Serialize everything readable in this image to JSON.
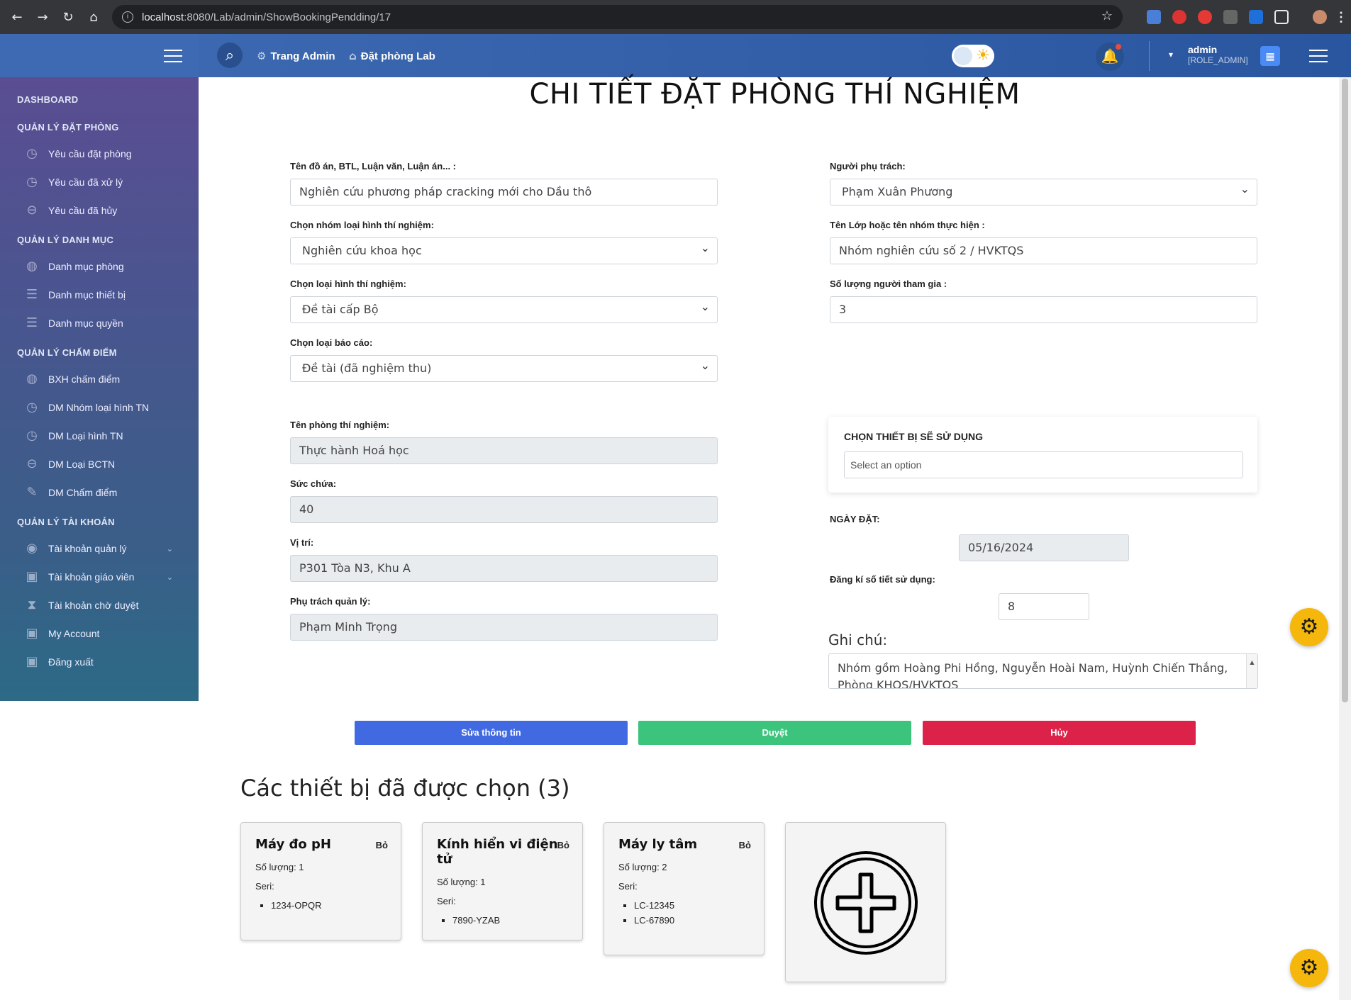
{
  "browser": {
    "url_host": "localhost",
    "url_path": ":8080/Lab/admin/ShowBookingPendding/17",
    "info_icon": "i",
    "back": "←",
    "forward": "→",
    "reload": "↻",
    "home": "⌂",
    "star": "☆"
  },
  "header": {
    "links": [
      "Trang Admin",
      "Đặt phòng Lab"
    ],
    "user_name": "admin",
    "user_role": "[ROLE_ADMIN]"
  },
  "sidebar": {
    "sections": [
      {
        "title": "DASHBOARD",
        "items": []
      },
      {
        "title": "QUẢN LÝ ĐẶT PHÒNG",
        "items": [
          {
            "label": "Yêu cầu đặt phòng",
            "icon": "clock-icon"
          },
          {
            "label": "Yêu cầu đã xử lý",
            "icon": "clock-icon"
          },
          {
            "label": "Yêu cầu đã hủy",
            "icon": "minus-circle-icon"
          }
        ]
      },
      {
        "title": "QUẢN LÝ DANH MỤC",
        "items": [
          {
            "label": "Danh mục phòng",
            "icon": "basketball-icon"
          },
          {
            "label": "Danh mục thiết bị",
            "icon": "database-icon"
          },
          {
            "label": "Danh mục quyền",
            "icon": "database-icon"
          }
        ]
      },
      {
        "title": "QUẢN LÝ CHẤM ĐIỂM",
        "items": [
          {
            "label": "BXH chấm điểm",
            "icon": "basketball-icon"
          },
          {
            "label": "DM Nhóm loại hình TN",
            "icon": "clock-icon"
          },
          {
            "label": "DM Loại hình TN",
            "icon": "clock-icon"
          },
          {
            "label": "DM Loại BCTN",
            "icon": "minus-circle-icon"
          },
          {
            "label": "DM Chấm điểm",
            "icon": "pencil-icon"
          }
        ]
      },
      {
        "title": "QUẢN LÝ TÀI KHOẢN",
        "items": [
          {
            "label": "Tài khoản quản lý",
            "icon": "badge-icon"
          },
          {
            "label": "Tài khoản giáo viên",
            "icon": "id-card-icon"
          },
          {
            "label": "Tài khoản chờ duyệt",
            "icon": "hourglass-icon"
          },
          {
            "label": "My Account",
            "icon": "id-card-icon"
          },
          {
            "label": "Đăng xuất",
            "icon": "id-card-icon"
          }
        ]
      }
    ]
  },
  "page": {
    "title": "CHI TIẾT ĐẶT PHÒNG THÍ NGHIỆM"
  },
  "form": {
    "project_name_label": "Tên đồ án, BTL, Luận văn, Luận án... :",
    "project_name_value": "Nghiên cứu phương pháp cracking mới cho Dầu thô",
    "exp_group_label": "Chọn nhóm loại hình thí nghiệm:",
    "exp_group_value": "Nghiên cứu khoa học",
    "exp_type_label": "Chọn loại hình thí nghiệm:",
    "exp_type_value": "Đề tài cấp Bộ",
    "report_type_label": "Chọn loại báo cáo:",
    "report_type_value": "Đề tài (đã nghiệm thu)",
    "lab_name_label": "Tên phòng thí nghiệm:",
    "lab_name_value": "Thực hành Hoá học",
    "capacity_label": "Sức chứa:",
    "capacity_value": "40",
    "location_label": "Vị trí:",
    "location_value": "P301 Tòa N3, Khu A",
    "manager_label": "Phụ trách quản lý:",
    "manager_value": "Phạm Minh Trọng",
    "supervisor_label": "Người phụ trách:",
    "supervisor_value": "Phạm Xuân Phương",
    "class_label": "Tên Lớp hoặc tên nhóm thực hiện :",
    "class_value": "Nhóm nghiên cứu số 2 / HVKTQS",
    "participants_label": "Số lượng người tham gia :",
    "participants_value": "3",
    "equip_title": "CHỌN THIẾT BỊ SẼ SỬ DỤNG",
    "equip_placeholder": "Select an option",
    "date_label": "NGÀY ĐẶT:",
    "date_value": "05/16/2024",
    "periods_label": "Đăng kí số tiết sử dụng:",
    "periods_value": "8",
    "note_label": "Ghi chú:",
    "note_value": "Nhóm gồm Hoàng Phi Hồng, Nguyễn Hoài Nam, Huỳnh Chiến Thắng, Phòng KHQS/HVKTQS"
  },
  "actions": {
    "edit": "Sửa thông tin",
    "approve": "Duyệt",
    "cancel": "Hủy"
  },
  "selected": {
    "title": "Các thiết bị đã được chọn (3)",
    "remove_label": "Bỏ",
    "qty_prefix": "Số lượng: ",
    "serial_label": "Seri:",
    "items": [
      {
        "name": "Máy đo pH",
        "quantity": "Số lượng: 1",
        "serials": [
          "1234-OPQR"
        ]
      },
      {
        "name": "Kính hiển vi điện tử",
        "quantity": "Số lượng: 1",
        "serials": [
          "7890-YZAB"
        ]
      },
      {
        "name": "Máy ly tâm",
        "quantity": "Số lượng: 2",
        "serials": [
          "LC-12345",
          "LC-67890"
        ]
      }
    ]
  },
  "colors": {
    "edit": "#4169e1",
    "approve": "#3cc47c",
    "cancel": "#dc2249",
    "header": "#2b5aa0",
    "gear": "#f5b70b"
  }
}
